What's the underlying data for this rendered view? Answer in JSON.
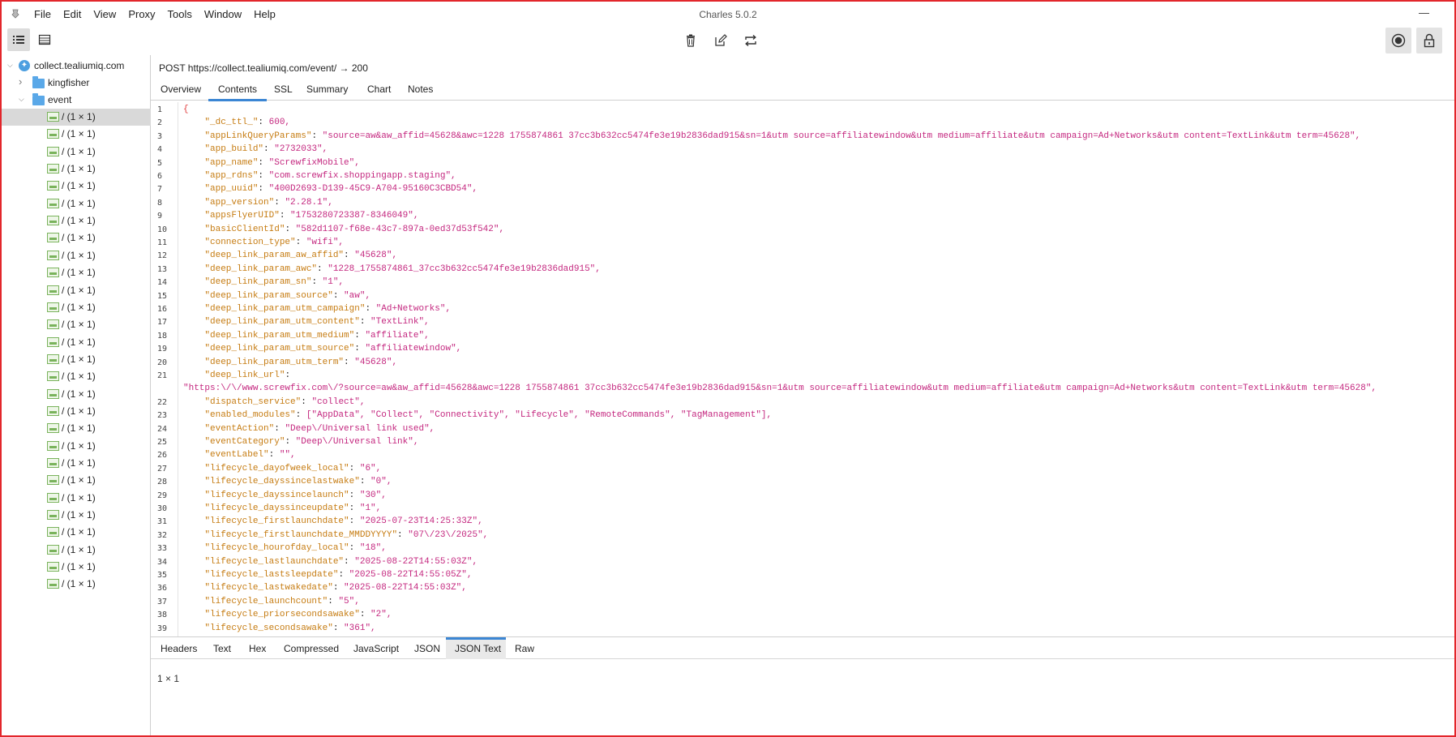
{
  "window": {
    "title": "Charles 5.0.2",
    "minimize": "—"
  },
  "menu": [
    "File",
    "Edit",
    "View",
    "Proxy",
    "Tools",
    "Window",
    "Help"
  ],
  "tree": {
    "host": "collect.tealiumiq.com",
    "folders": [
      "kingfisher",
      "event"
    ],
    "item_label": "/ (1 × 1)",
    "item_count": 28
  },
  "request": {
    "line": "POST https://collect.tealiumiq.com/event/  → 200"
  },
  "tabs": [
    "Overview",
    "Contents",
    "SSL",
    "Summary",
    "Chart",
    "Notes"
  ],
  "active_tab": "Contents",
  "bottom_tabs": [
    "Headers",
    "Text",
    "Hex",
    "Compressed",
    "JavaScript",
    "JSON",
    "JSON Text",
    "Raw"
  ],
  "active_bottom_tab": "JSON Text",
  "status": "1 × 1",
  "code_lines": [
    {
      "n": "1",
      "t": "{"
    },
    {
      "n": "2",
      "k": "\"_dc_ttl_\"",
      "v": "600,"
    },
    {
      "n": "3",
      "k": "\"appLinkQueryParams\"",
      "v": "\"source=aw&aw_affid=45628&awc=1228 1755874861 37cc3b632cc5474fe3e19b2836dad915&sn=1&utm source=affiliatewindow&utm medium=affiliate&utm campaign=Ad+Networks&utm content=TextLink&utm term=45628\","
    },
    {
      "n": "4",
      "k": "\"app_build\"",
      "v": "\"2732033\","
    },
    {
      "n": "5",
      "k": "\"app_name\"",
      "v": "\"ScrewfixMobile\","
    },
    {
      "n": "6",
      "k": "\"app_rdns\"",
      "v": "\"com.screwfix.shoppingapp.staging\","
    },
    {
      "n": "7",
      "k": "\"app_uuid\"",
      "v": "\"400D2693-D139-45C9-A704-95160C3CBD54\","
    },
    {
      "n": "8",
      "k": "\"app_version\"",
      "v": "\"2.28.1\","
    },
    {
      "n": "9",
      "k": "\"appsFlyerUID\"",
      "v": "\"1753280723387-8346049\","
    },
    {
      "n": "10",
      "k": "\"basicClientId\"",
      "v": "\"582d1107-f68e-43c7-897a-0ed37d53f542\","
    },
    {
      "n": "11",
      "k": "\"connection_type\"",
      "v": "\"wifi\","
    },
    {
      "n": "12",
      "k": "\"deep_link_param_aw_affid\"",
      "v": "\"45628\","
    },
    {
      "n": "13",
      "k": "\"deep_link_param_awc\"",
      "v": "\"1228_1755874861_37cc3b632cc5474fe3e19b2836dad915\","
    },
    {
      "n": "14",
      "k": "\"deep_link_param_sn\"",
      "v": "\"1\","
    },
    {
      "n": "15",
      "k": "\"deep_link_param_source\"",
      "v": "\"aw\","
    },
    {
      "n": "16",
      "k": "\"deep_link_param_utm_campaign\"",
      "v": "\"Ad+Networks\","
    },
    {
      "n": "17",
      "k": "\"deep_link_param_utm_content\"",
      "v": "\"TextLink\","
    },
    {
      "n": "18",
      "k": "\"deep_link_param_utm_medium\"",
      "v": "\"affiliate\","
    },
    {
      "n": "19",
      "k": "\"deep_link_param_utm_source\"",
      "v": "\"affiliatewindow\","
    },
    {
      "n": "20",
      "k": "\"deep_link_param_utm_term\"",
      "v": "\"45628\","
    },
    {
      "n": "21",
      "k": "\"deep_link_url\"",
      "v": "",
      "wrap": "\"https:\\/\\/www.screwfix.com\\/?source=aw&aw_affid=45628&awc=1228 1755874861 37cc3b632cc5474fe3e19b2836dad915&sn=1&utm source=affiliatewindow&utm medium=affiliate&utm campaign=Ad+Networks&utm content=TextLink&utm term=45628\","
    },
    {
      "n": "22",
      "k": "\"dispatch_service\"",
      "v": "\"collect\","
    },
    {
      "n": "23",
      "k": "\"enabled_modules\"",
      "v": "[\"AppData\", \"Collect\", \"Connectivity\", \"Lifecycle\", \"RemoteCommands\", \"TagManagement\"],"
    },
    {
      "n": "24",
      "k": "\"eventAction\"",
      "v": "\"Deep\\/Universal link used\","
    },
    {
      "n": "25",
      "k": "\"eventCategory\"",
      "v": "\"Deep\\/Universal link\","
    },
    {
      "n": "26",
      "k": "\"eventLabel\"",
      "v": "\"\","
    },
    {
      "n": "27",
      "k": "\"lifecycle_dayofweek_local\"",
      "v": "\"6\","
    },
    {
      "n": "28",
      "k": "\"lifecycle_dayssincelastwake\"",
      "v": "\"0\","
    },
    {
      "n": "29",
      "k": "\"lifecycle_dayssincelaunch\"",
      "v": "\"30\","
    },
    {
      "n": "30",
      "k": "\"lifecycle_dayssinceupdate\"",
      "v": "\"1\","
    },
    {
      "n": "31",
      "k": "\"lifecycle_firstlaunchdate\"",
      "v": "\"2025-07-23T14:25:33Z\","
    },
    {
      "n": "32",
      "k": "\"lifecycle_firstlaunchdate_MMDDYYYY\"",
      "v": "\"07\\/23\\/2025\","
    },
    {
      "n": "33",
      "k": "\"lifecycle_hourofday_local\"",
      "v": "\"18\","
    },
    {
      "n": "34",
      "k": "\"lifecycle_lastlaunchdate\"",
      "v": "\"2025-08-22T14:55:03Z\","
    },
    {
      "n": "35",
      "k": "\"lifecycle_lastsleepdate\"",
      "v": "\"2025-08-22T14:55:05Z\","
    },
    {
      "n": "36",
      "k": "\"lifecycle_lastwakedate\"",
      "v": "\"2025-08-22T14:55:03Z\","
    },
    {
      "n": "37",
      "k": "\"lifecycle_launchcount\"",
      "v": "\"5\","
    },
    {
      "n": "38",
      "k": "\"lifecycle_priorsecondsawake\"",
      "v": "\"2\","
    },
    {
      "n": "39",
      "k": "\"lifecycle_secondsawake\"",
      "v": "\"361\","
    }
  ]
}
